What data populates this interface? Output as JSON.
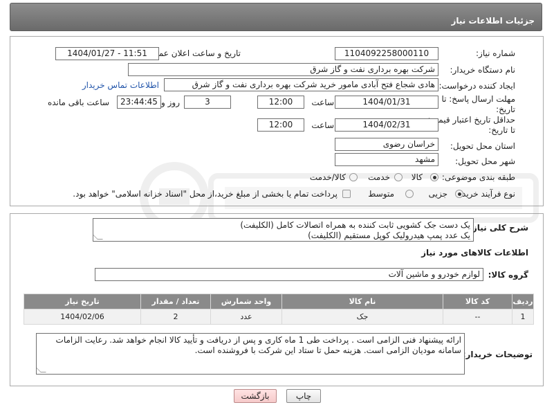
{
  "header": {
    "title": "جزئیات اطلاعات نیاز"
  },
  "form": {
    "need_number": {
      "label": "شماره نیاز:",
      "value": "1104092258000110"
    },
    "announce_datetime": {
      "label": "تاریخ و ساعت اعلان عمومی:",
      "value": "1404/01/27 - 11:51"
    },
    "buyer_org": {
      "label": "نام دستگاه خریدار:",
      "value": "شرکت بهره برداری نفت و گاز شرق"
    },
    "requester": {
      "label": "ایجاد کننده درخواست:",
      "value": "هادی شجاع فتح آبادی مامور خرید شرکت بهره برداری نفت و گاز شرق",
      "contact_link": "اطلاعات تماس خریدار"
    },
    "reply_deadline": {
      "label_line1": "مهلت ارسال پاسخ: تا",
      "label_line2": "تاریخ:",
      "date": "1404/01/31",
      "time_label": "ساعت",
      "time": "12:00",
      "days": "3",
      "days_label": "روز و",
      "remaining": "23:44:45",
      "remaining_label": "ساعت باقی مانده"
    },
    "price_validity": {
      "label_line1": "حداقل تاریخ اعتبار قیمت:",
      "label_line2": "تا تاریخ:",
      "date": "1404/02/31",
      "time_label": "ساعت",
      "time": "12:00"
    },
    "delivery_province": {
      "label": "استان محل تحویل:",
      "value": "خراسان رضوی"
    },
    "delivery_city": {
      "label": "شهر محل تحویل:",
      "value": "مشهد"
    },
    "category": {
      "label": "طبقه بندی موضوعی:",
      "options": [
        "کالا",
        "خدمت",
        "کالا/خدمت"
      ],
      "selected": "کالا"
    },
    "purchase_type": {
      "label": "نوع فرآیند خرید :",
      "options": [
        "جزیی",
        "متوسط"
      ],
      "selected": "جزیی",
      "note": "پرداخت تمام یا بخشی از مبلغ خرید،از محل \"اسناد خزانه اسلامی\" خواهد بود."
    }
  },
  "description": {
    "label": "شرح کلی نیاز:",
    "line1": "یک دست جک کشویی ثابت کننده به همراه اتصالات کامل (الکلیفت)",
    "line2": "یک عدد پمپ هیدرولیک کوپل مستقیم (الکلیفت)"
  },
  "goods_info": {
    "title": "اطلاعات کالاهای مورد نیاز",
    "group_label": "گروه کالا:",
    "group_value": "لوازم خودرو و ماشین آلات"
  },
  "table": {
    "headers": [
      "ردیف",
      "کد کالا",
      "نام کالا",
      "واحد شمارش",
      "تعداد / مقدار",
      "تاریخ نیاز"
    ],
    "rows": [
      [
        "1",
        "--",
        "جک",
        "عدد",
        "2",
        "1404/02/06"
      ]
    ]
  },
  "buyer_notes": {
    "label": "توضیحات خریدار:",
    "line1": "ارائه پیشنهاد فنی الزامی است . پرداخت طی  1 ماه کاری و پس از دریافت و تأیید کالا انجام خواهد شد. رعایت الزامات",
    "line2": "سامانه مودیان الزامی است. هزینه حمل تا ستاد این شرکت با فروشنده است."
  },
  "buttons": {
    "print": "چاپ",
    "back": "بازگشت"
  },
  "colors": {
    "header_bg": "#7a7a7a",
    "table_header_bg": "#8a8a8a",
    "link": "#2255aa"
  }
}
